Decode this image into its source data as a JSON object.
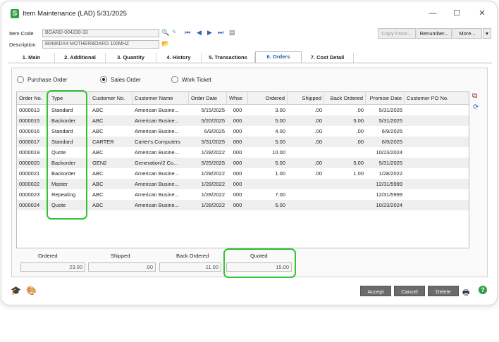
{
  "window": {
    "title": "Item Maintenance (LAD) 5/31/2025",
    "app_icon": "S"
  },
  "controls": {
    "minimize": "—",
    "maximize": "☐",
    "close": "✕"
  },
  "fields": {
    "item_code_label": "Item Code",
    "item_code_value": "BOARD-004230-33",
    "description_label": "Description",
    "description_value": "80486DX4 MOTHERBOARD 100MHZ"
  },
  "toolbar": {
    "copy_from": "Copy From...",
    "renumber": "Renumber...",
    "more": "More...",
    "more_arrow": "▾"
  },
  "tabs": [
    "1. Main",
    "2. Additional",
    "3. Quantity",
    "4. History",
    "5. Transactions",
    "6. Orders",
    "7. Cost Detail"
  ],
  "radios": {
    "purchase_order": "Purchase Order",
    "sales_order": "Sales Order",
    "work_ticket": "Work Ticket",
    "selected": "Sales Order"
  },
  "grid": {
    "columns": [
      "Order No.",
      "Type",
      "Customer No.",
      "Customer Name",
      "Order Date",
      "Whse",
      "Ordered",
      "Shipped",
      "Back Ordered",
      "Promise Date",
      "Customer PO No."
    ],
    "rows": [
      [
        "0000013",
        "Standard",
        "ABC",
        "American Busine...",
        "5/15/2025",
        "000",
        "3.00",
        ".00",
        ".00",
        "5/31/2025",
        ""
      ],
      [
        "0000015",
        "Backorder",
        "ABC",
        "American Busine...",
        "5/20/2025",
        "000",
        "5.00",
        ".00",
        "5.00",
        "5/31/2025",
        ""
      ],
      [
        "0000016",
        "Standard",
        "ABC",
        "American Busine...",
        "6/9/2025",
        "000",
        "4.00",
        ".00",
        ".00",
        "6/9/2025",
        ""
      ],
      [
        "0000017",
        "Standard",
        "CARTER",
        "Carter's Computers",
        "5/31/2025",
        "000",
        "5.00",
        ".00",
        ".00",
        "6/9/2025",
        ""
      ],
      [
        "0000019",
        "Quote",
        "ABC",
        "American Busine...",
        "1/28/2022",
        "000",
        "10.00",
        "",
        "",
        "10/23/2024",
        ""
      ],
      [
        "0000020",
        "Backorder",
        "GEN2",
        "Generation/2 Co...",
        "5/25/2025",
        "000",
        "5.00",
        ".00",
        "5.00",
        "5/31/2025",
        ""
      ],
      [
        "0000021",
        "Backorder",
        "ABC",
        "American Busine...",
        "1/28/2022",
        "000",
        "1.00",
        ".00",
        "1.00",
        "1/28/2022",
        ""
      ],
      [
        "0000022",
        "Master",
        "ABC",
        "American Busine...",
        "1/28/2022",
        "000",
        "",
        "",
        "",
        "12/31/5999",
        ""
      ],
      [
        "0000023",
        "Repeating",
        "ABC",
        "American Busine...",
        "1/28/2022",
        "000",
        "7.00",
        "",
        "",
        "12/31/5999",
        ""
      ],
      [
        "0000024",
        "Quote",
        "ABC",
        "American Busine...",
        "1/28/2022",
        "000",
        "5.00",
        "",
        "",
        "10/23/2024",
        ""
      ]
    ]
  },
  "totals": {
    "ordered_label": "Ordered",
    "ordered_value": "23.00",
    "shipped_label": "Shipped",
    "shipped_value": ".00",
    "back_ordered_label": "Back Ordered",
    "back_ordered_value": "11.00",
    "quoted_label": "Quoted",
    "quoted_value": "15.00"
  },
  "buttons": {
    "accept": "Accept",
    "cancel": "Cancel",
    "delete": "Delete"
  },
  "icons": {
    "search": "search-icon",
    "erase": "erase-icon",
    "first": "first-record-icon",
    "prev": "previous-record-icon",
    "next": "next-record-icon",
    "last": "last-record-icon",
    "list": "list-icon",
    "folder": "folder-icon",
    "print": "printer-icon",
    "help": "help-icon"
  },
  "colors": {
    "highlight": "#35c235",
    "active_tab": "#1d5ea8",
    "button_dark": "#6b6b6b",
    "app_icon": "#2ea043"
  }
}
